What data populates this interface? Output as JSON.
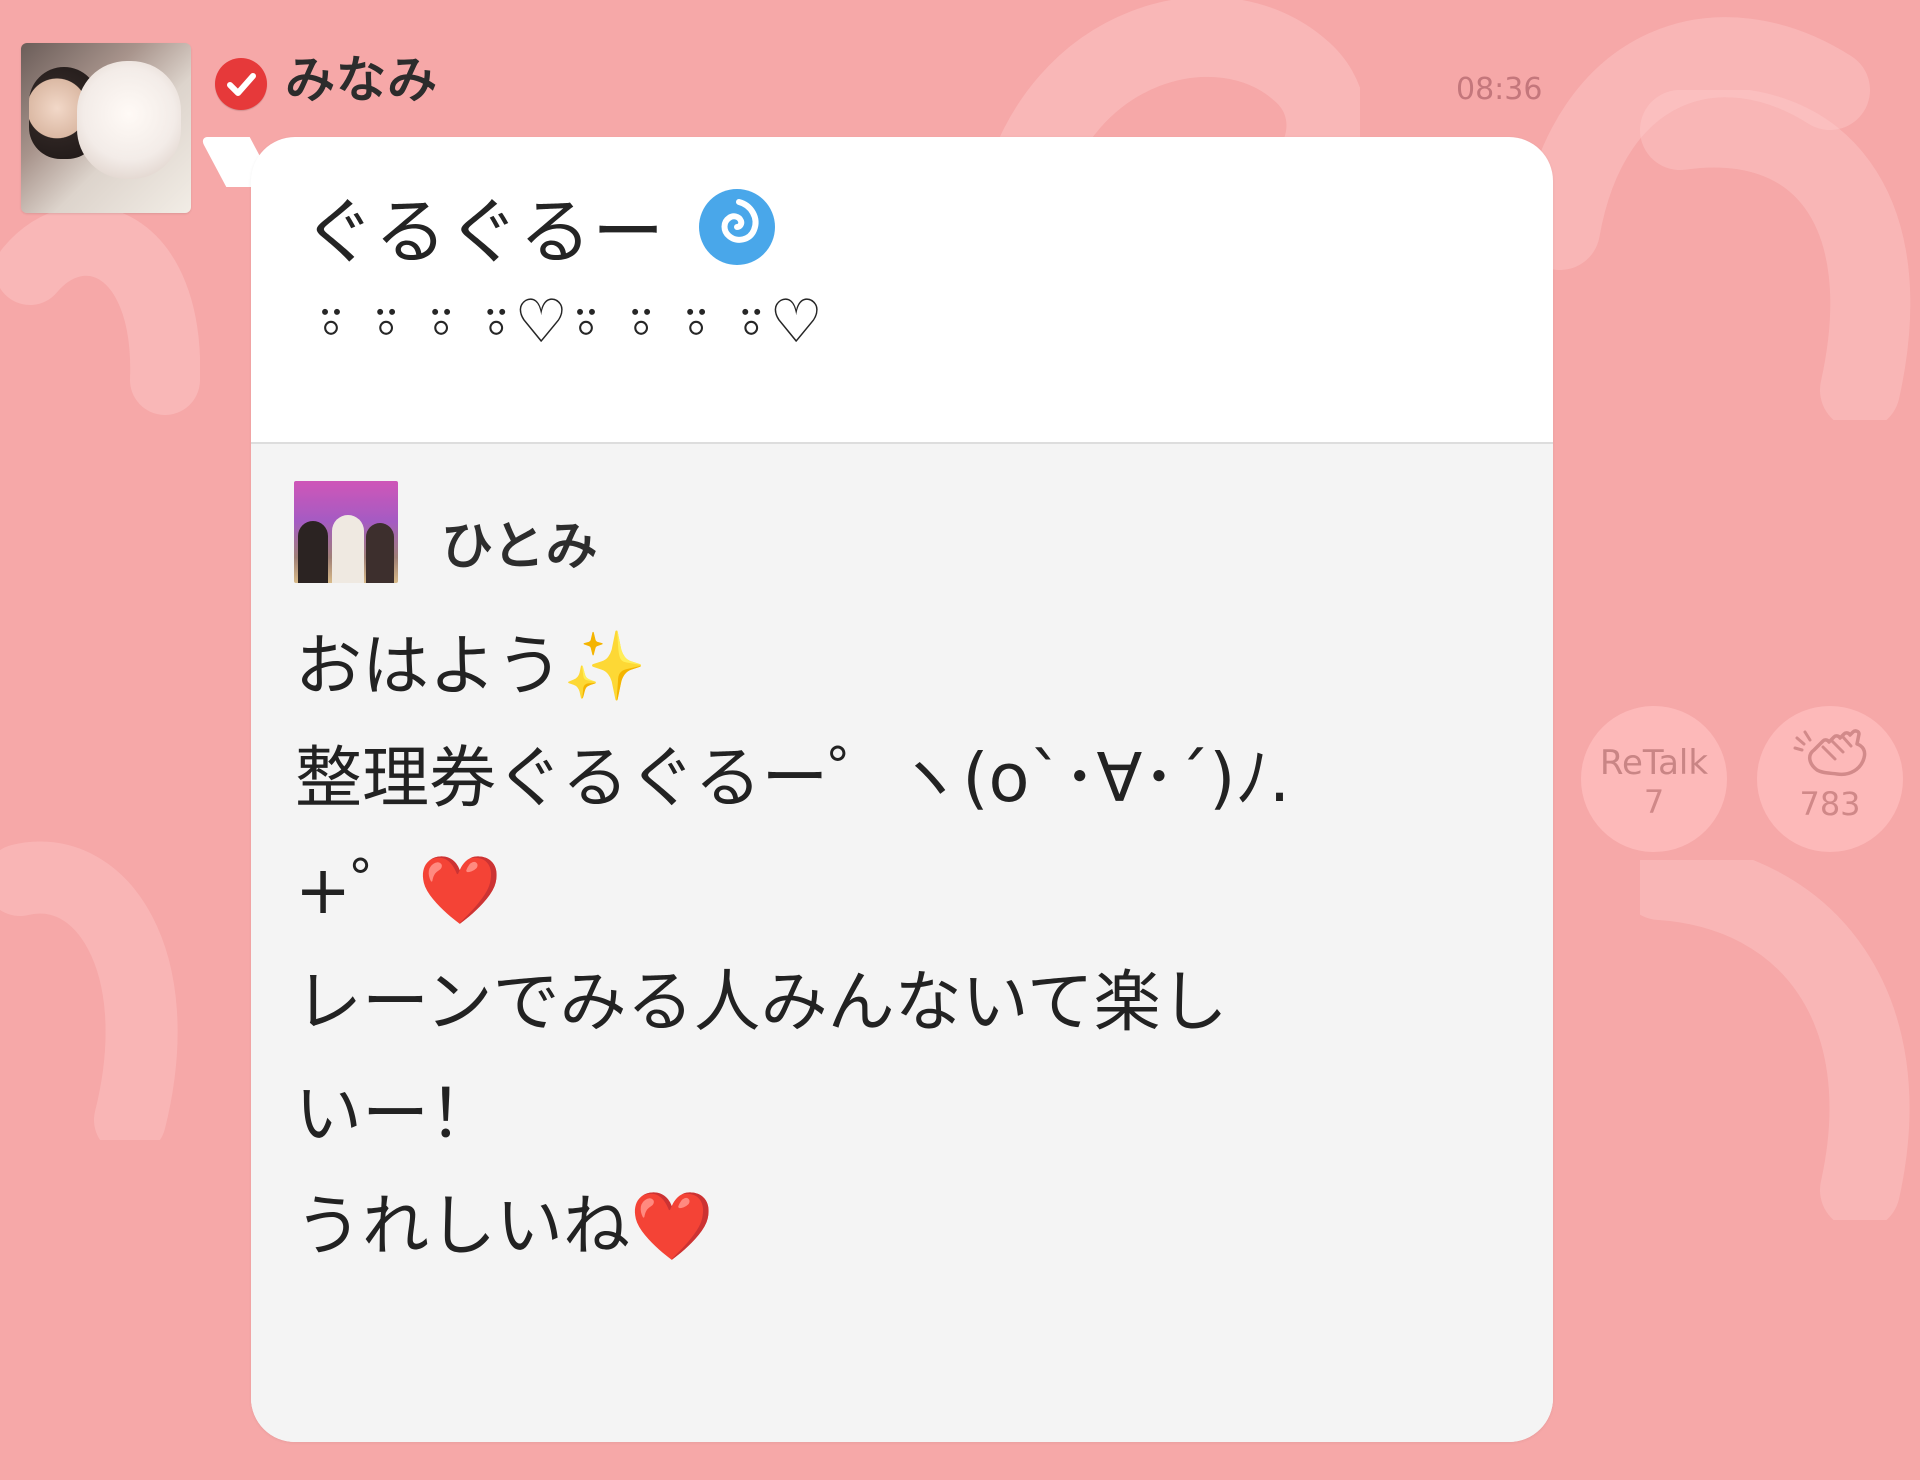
{
  "post": {
    "sender": {
      "name": "みなみ",
      "verified_icon": "check-circle-icon"
    },
    "timestamp": "08:36",
    "message": {
      "line1": "ぐるぐるー",
      "line1_icon": "swirl-icon",
      "line2": "⍤ ⍤ ⍤ ⍤♡⍤ ⍤ ⍤ ⍤♡"
    },
    "quote": {
      "name": "ひとみ",
      "text": "おはよう✨\n整理券ぐるぐるー゜ヽ(o`･∀･´)ﾉ.\n+゜❤️\nレーンでみる人みんないて楽し\nいー！\nうれしいね❤️"
    }
  },
  "actions": {
    "retalk": {
      "label": "ReTalk",
      "count": "7"
    },
    "clap": {
      "count": "783",
      "icon": "clap-icon"
    }
  },
  "colors": {
    "background": "#f6a8a8",
    "bubble": "#ffffff",
    "quote_bg": "#f4f4f4",
    "badge": "#e6393a",
    "timestamp": "#c4777c",
    "action_button": "#fdb9b9"
  }
}
